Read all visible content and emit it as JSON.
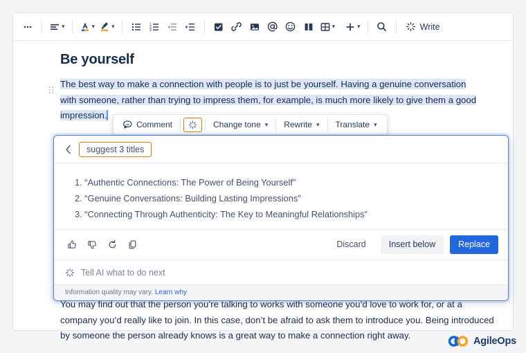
{
  "toolbar": {
    "more_label": "•••",
    "items": [
      {
        "name": "more-options",
        "icon": "ellipsis-icon",
        "label": "",
        "chevron": false
      },
      {
        "name": "text-align",
        "icon": "text-align-icon",
        "label": "",
        "chevron": true
      },
      {
        "name": "text-color",
        "icon": "text-color-icon",
        "label": "",
        "chevron": true
      },
      {
        "name": "highlight-color",
        "icon": "highlighter-icon",
        "label": "",
        "chevron": true
      },
      {
        "name": "bullet-list",
        "icon": "bullet-list-icon",
        "label": "",
        "chevron": false
      },
      {
        "name": "numbered-list",
        "icon": "numbered-list-icon",
        "label": "",
        "chevron": false
      },
      {
        "name": "outdent",
        "icon": "outdent-icon",
        "label": "",
        "chevron": false
      },
      {
        "name": "indent",
        "icon": "indent-icon",
        "label": "",
        "chevron": false
      },
      {
        "name": "action-item",
        "icon": "checkbox-icon",
        "label": "",
        "chevron": false
      },
      {
        "name": "link",
        "icon": "link-icon",
        "label": "",
        "chevron": false
      },
      {
        "name": "image",
        "icon": "image-icon",
        "label": "",
        "chevron": false
      },
      {
        "name": "mention",
        "icon": "mention-at-icon",
        "label": "",
        "chevron": false
      },
      {
        "name": "emoji",
        "icon": "emoji-smiley-icon",
        "label": "",
        "chevron": false
      },
      {
        "name": "layout",
        "icon": "columns-layout-icon",
        "label": "",
        "chevron": false
      },
      {
        "name": "table",
        "icon": "table-icon",
        "label": "",
        "chevron": true
      },
      {
        "name": "insert-more",
        "icon": "plus-icon",
        "label": "",
        "chevron": true
      },
      {
        "name": "find-replace",
        "icon": "search-icon",
        "label": "",
        "chevron": false
      }
    ],
    "write_label": "Write",
    "write_icon": "ai-sparkle-icon"
  },
  "document": {
    "title": "Be yourself",
    "selected_paragraph": "The best way to make a connection with people is to just be yourself. Having a genuine conversation with someone, rather than trying to impress them, for example, is much more likely to give them a good impression.",
    "bottom_paragraph": "You may find out that the person you’re talking to works with someone you’d love to work for, or at a company you’d really like to join. In this case, don’t be afraid to ask them to introduce you. Being introduced by someone the person already knows is a great way to make a connection right away.",
    "selection_color": "#dce6f7"
  },
  "selection_toolbar": {
    "comment_label": "Comment",
    "comment_icon": "comment-bubble-icon",
    "ai_icon": "ai-sparkle-icon",
    "change_tone_label": "Change tone",
    "rewrite_label": "Rewrite",
    "translate_label": "Translate",
    "highlight_border_color": "#e8770a"
  },
  "ai_panel": {
    "back_icon": "chevron-left-icon",
    "prompt_chip": "suggest 3 titles",
    "chip_border_color": "#e8770a",
    "border_color": "#4c7ce0",
    "results": [
      "1. “Authentic Connections: The Power of Being Yourself”",
      "2. “Genuine Conversations: Building Lasting Impressions”",
      "3. “Connecting Through Authenticity: The Key to Meaningful Relationships”"
    ],
    "feedback_icons": [
      {
        "name": "thumbs-up-icon"
      },
      {
        "name": "thumbs-down-icon"
      },
      {
        "name": "retry-refresh-icon"
      },
      {
        "name": "copy-icon"
      }
    ],
    "discard_label": "Discard",
    "insert_below_label": "Insert below",
    "replace_label": "Replace",
    "replace_color": "#2267dd",
    "input_placeholder": "Tell AI what to do next",
    "input_icon": "ai-sparkle-icon",
    "input_value": "",
    "footer_text": "Information quality may vary.",
    "footer_link": "Learn why"
  },
  "branding": {
    "name": "AgileOps",
    "logo_icon": "agileops-infinity-logo",
    "color_blue": "#1267d6",
    "color_orange": "#f5a623",
    "text_color": "#1b3a6b"
  }
}
